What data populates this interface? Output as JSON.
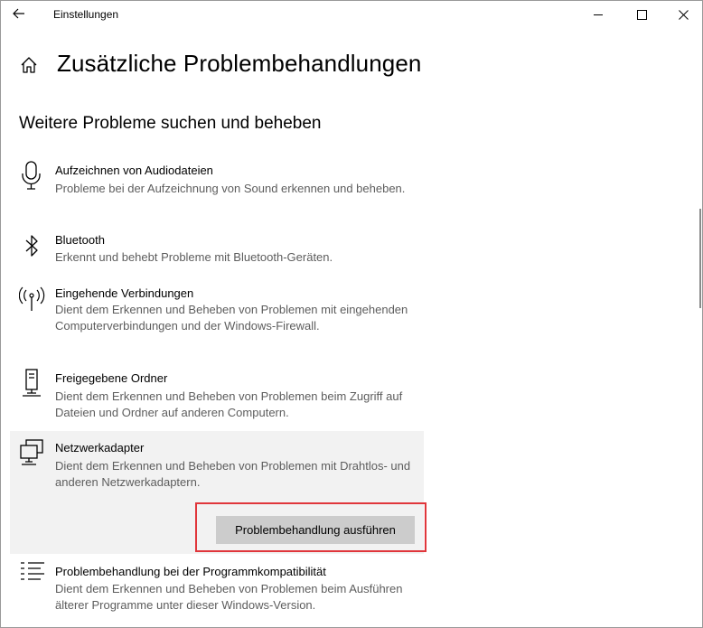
{
  "window": {
    "title": "Einstellungen",
    "icons": {
      "back": "back-arrow-icon",
      "minimize": "minimize-icon",
      "maximize": "maximize-icon",
      "close": "close-icon"
    }
  },
  "page": {
    "title": "Zusätzliche Problembehandlungen",
    "section_title": "Weitere Probleme suchen und beheben"
  },
  "items": [
    {
      "icon": "microphone-icon",
      "name": "Aufzeichnen von Audiodateien",
      "desc": "Probleme bei der Aufzeichnung von Sound erkennen und beheben."
    },
    {
      "icon": "bluetooth-icon",
      "name": "Bluetooth",
      "desc": "Erkennt und behebt Probleme mit Bluetooth-Geräten."
    },
    {
      "icon": "antenna-icon",
      "name": "Eingehende Verbindungen",
      "desc": "Dient dem Erkennen und Beheben von Problemen mit eingehenden Computerverbindungen und der Windows-Firewall."
    },
    {
      "icon": "shared-folder-icon",
      "name": "Freigegebene Ordner",
      "desc": "Dient dem Erkennen und Beheben von Problemen beim Zugriff auf Dateien und Ordner auf anderen Computern."
    },
    {
      "icon": "network-adapter-icon",
      "name": "Netzwerkadapter",
      "desc": "Dient dem Erkennen und Beheben von Problemen mit Drahtlos- und anderen Netzwerkadaptern.",
      "selected": true
    },
    {
      "icon": "list-icon",
      "name": "Problembehandlung bei der Programmkompatibilität",
      "desc": "Dient dem Erkennen und Beheben von Problemen beim Ausführen älterer Programme unter dieser Windows-Version."
    }
  ],
  "run_button_label": "Problembehandlung ausführen",
  "colors": {
    "highlight": "#e0363b",
    "selected_bg": "#f2f2f2",
    "button_bg": "#cccccc",
    "desc_text": "#5d5d5d"
  }
}
